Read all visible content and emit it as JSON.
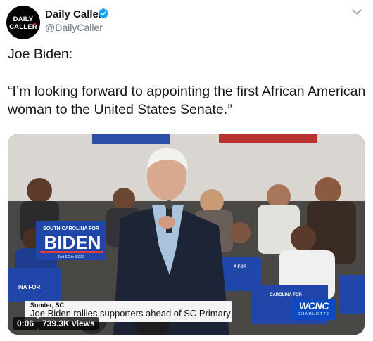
{
  "author": {
    "avatar_line1": "DAILY",
    "avatar_line2": "CALLER",
    "name": "Daily Caller",
    "handle": "@DailyCaller",
    "verified": true
  },
  "tweet": {
    "line1": "Joe Biden:",
    "line2": "“I’m looking forward to appointing the first African American woman to the United States Senate.”"
  },
  "video": {
    "chyron_location": "Sumter, SC",
    "chyron_headline": "Joe Biden rallies supporters ahead of SC Primary",
    "station_logo": "WCNC",
    "station_city": "CHARLOTTE",
    "sign_header": "SOUTH CAROLINA FOR",
    "sign_name": "BIDEN",
    "sign_footer": "Text SC to 30330",
    "elapsed": "0:06",
    "views": "739.3K views"
  },
  "colors": {
    "verified": "#1da1f2",
    "sign_blue": "#1f46a8",
    "station_blue": "#0d49c0"
  },
  "icons": [
    "verified-badge-icon",
    "chevron-down-icon"
  ]
}
